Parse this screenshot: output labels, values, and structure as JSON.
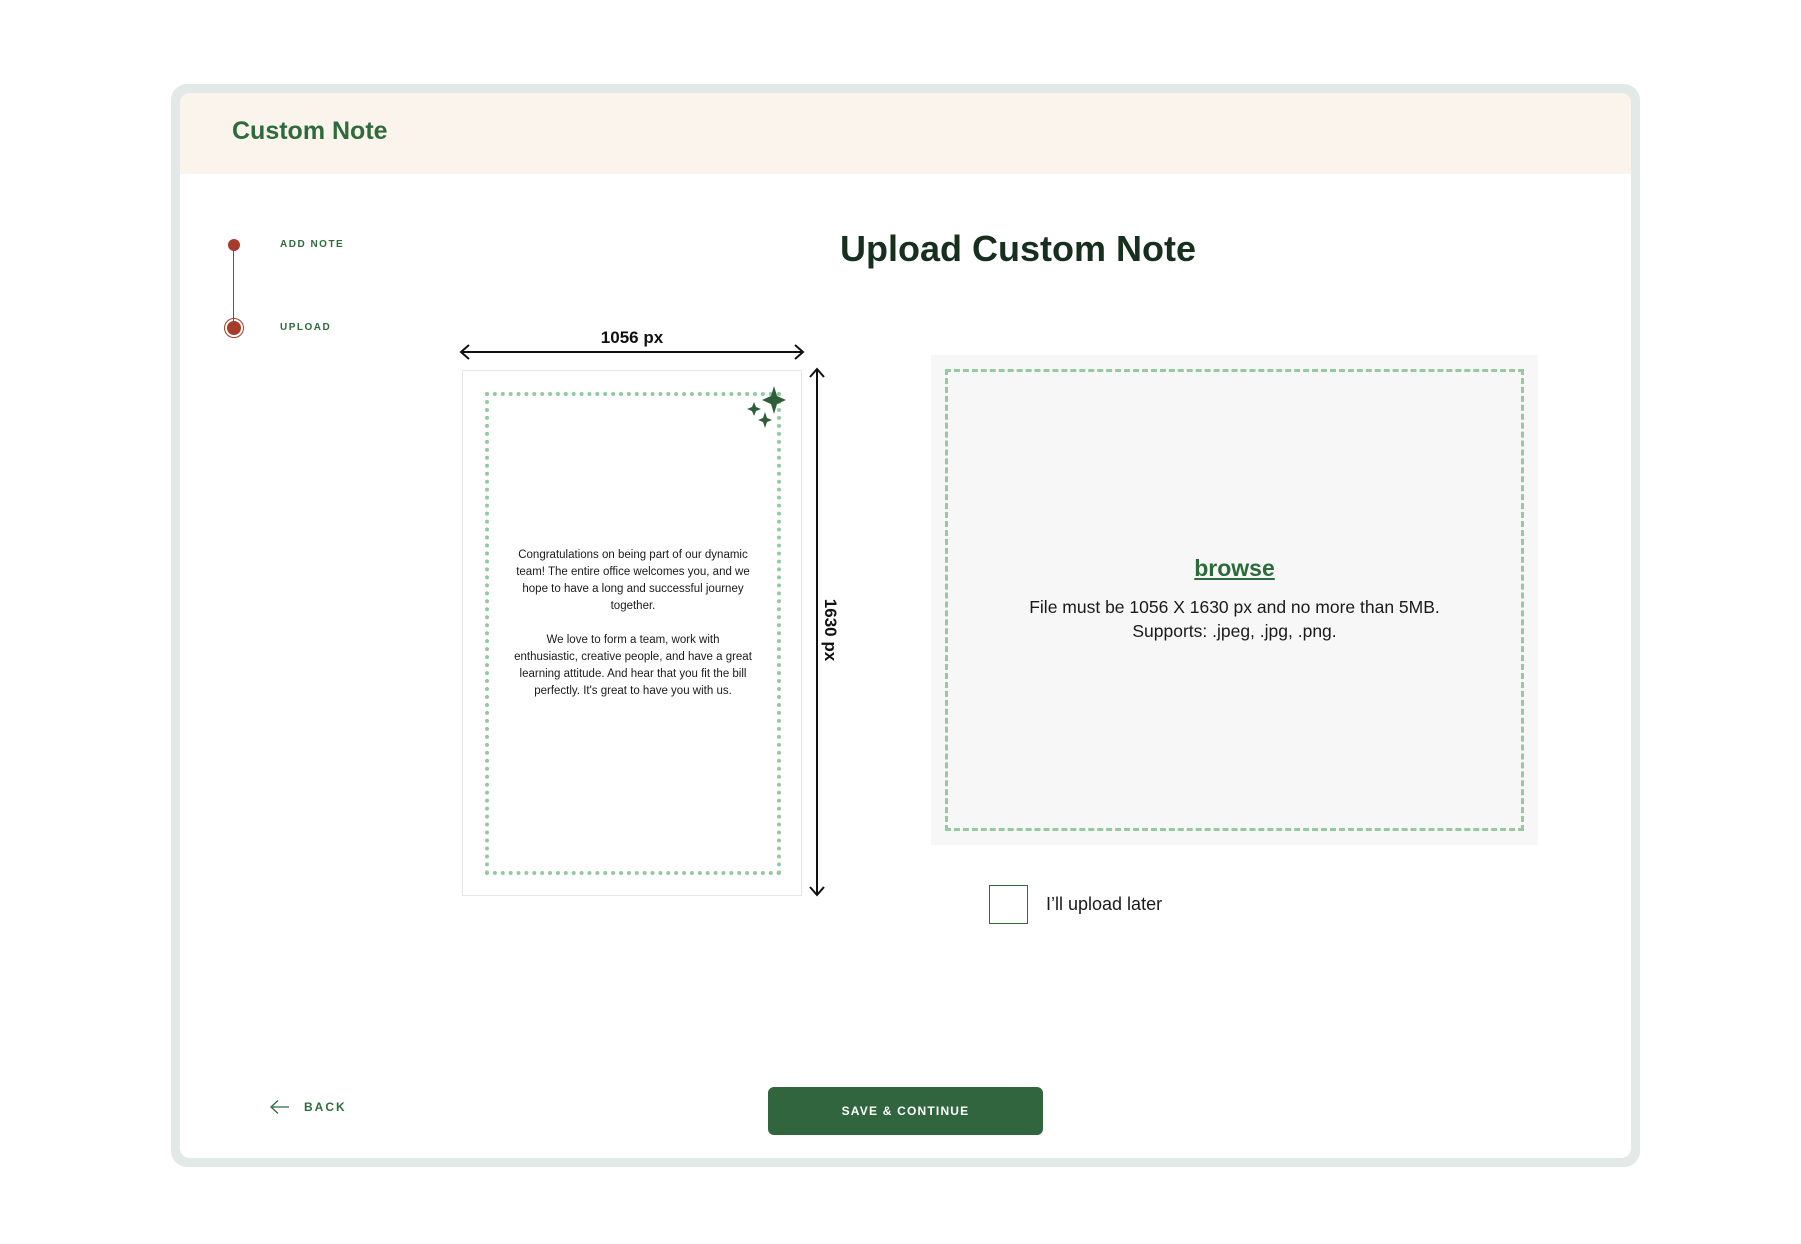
{
  "header": {
    "title": "Custom Note"
  },
  "steps": [
    {
      "label": "ADD NOTE",
      "state": "completed"
    },
    {
      "label": "UPLOAD",
      "state": "current"
    }
  ],
  "main": {
    "title": "Upload Custom Note"
  },
  "preview": {
    "width_label": "1056 px",
    "height_label": "1630 px",
    "paragraphs": [
      "Congratulations on being part of our dynamic team! The entire office welcomes you, and we hope to have a long and successful journey together.",
      "We love to form a team, work with enthusiastic, creative people, and have a great learning attitude. And hear that you fit the bill perfectly. It's great to have you with us."
    ]
  },
  "upload": {
    "browse_label": "browse",
    "requirement": "File must be 1056 X 1630 px and no more than 5MB.",
    "supports": "Supports: .jpeg, .jpg, .png."
  },
  "upload_later": {
    "label": "I’ll upload later",
    "checked": false
  },
  "footer": {
    "back_label": "BACK",
    "save_label": "SAVE & CONTINUE"
  },
  "colors": {
    "brand_green": "#2e6b3c",
    "button_green": "#31653d",
    "step_red": "#a63b2c",
    "header_bg": "#fbf4ec",
    "dash_green": "#95c9a0"
  }
}
